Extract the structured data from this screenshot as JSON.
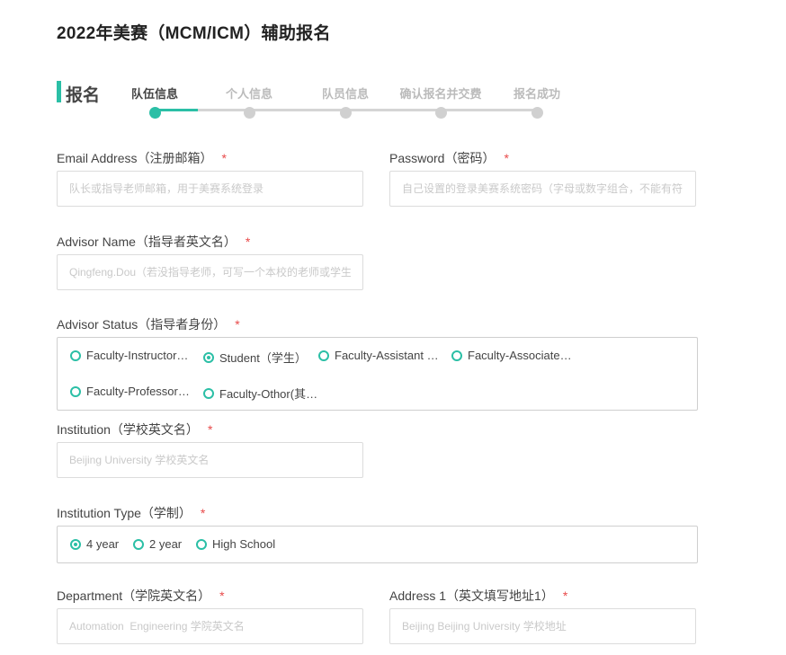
{
  "page_title": "2022年美赛（MCM/ICM）辅助报名",
  "section": {
    "title": "报名"
  },
  "steps": {
    "active_index": 0,
    "items": [
      "队伍信息",
      "个人信息",
      "队员信息",
      "确认报名并交费",
      "报名成功"
    ]
  },
  "required_mark": "*",
  "form": {
    "email": {
      "label": "Email Address（注册邮箱）",
      "placeholder": "队长或指导老师邮箱，用于美赛系统登录",
      "value": ""
    },
    "password": {
      "label": "Password（密码）",
      "placeholder": "自己设置的登录美赛系统密码（字母或数字组合，不能有符",
      "value": ""
    },
    "advisor_name": {
      "label": "Advisor Name（指导者英文名）",
      "placeholder": "Qingfeng.Dou（若没指导老师，可写一个本校的老师或学生",
      "value": ""
    },
    "advisor_status": {
      "label": "Advisor Status（指导者身份）",
      "selected": "Student（学生）",
      "options": [
        "Faculty-Instructor…",
        "Student（学生）",
        "Faculty-Assistant …",
        "Faculty-Associate…",
        "Faculty-Professor…",
        "Faculty-Othor(其…"
      ]
    },
    "institution": {
      "label": "Institution（学校英文名）",
      "placeholder": "Beijing University 学校英文名",
      "value": ""
    },
    "institution_type": {
      "label": "Institution Type（学制）",
      "selected": "4 year",
      "options": [
        "4 year",
        "2 year",
        "High School"
      ]
    },
    "department": {
      "label": "Department（学院英文名）",
      "placeholder": "Automation  Engineering 学院英文名",
      "value": ""
    },
    "address1": {
      "label": "Address 1（英文填写地址1）",
      "placeholder": "Beijing Beijing University 学校地址",
      "value": ""
    }
  },
  "colors": {
    "accent": "#2bbfa6",
    "required": "#e84a4a",
    "step_inactive": "#d0d0d0"
  },
  "icons": {
    "radio": "radio-circle-icon"
  }
}
